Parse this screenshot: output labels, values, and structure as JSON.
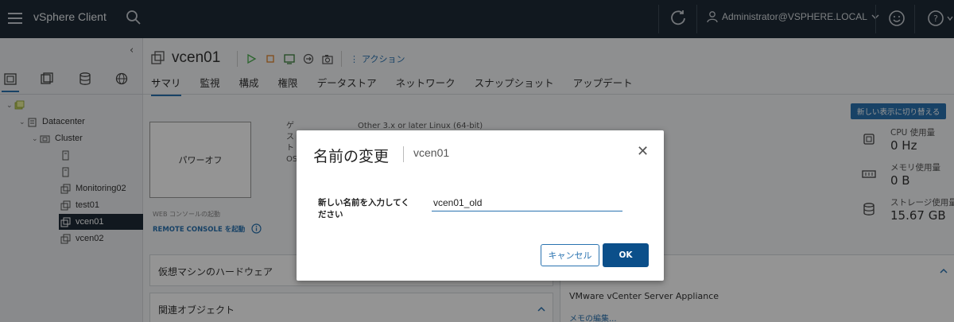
{
  "header": {
    "app_title": "vSphere Client",
    "user": "Administrator@VSPHERE.LOCAL",
    "icons": [
      "menu-icon",
      "search-icon",
      "refresh-icon",
      "user-icon",
      "feedback-icon",
      "help-icon"
    ]
  },
  "nav": {
    "tree": [
      {
        "label": "",
        "type": "vcenter"
      },
      {
        "label": "Datacenter",
        "type": "datacenter"
      },
      {
        "label": "Cluster",
        "type": "cluster"
      },
      {
        "label": "",
        "type": "vm"
      },
      {
        "label": "",
        "type": "vm"
      },
      {
        "label": "Monitoring02",
        "type": "vm"
      },
      {
        "label": "test01",
        "type": "vm"
      },
      {
        "label": "vcen01",
        "type": "vm",
        "selected": true
      },
      {
        "label": "vcen02",
        "type": "vm"
      }
    ]
  },
  "vm": {
    "name": "vcen01",
    "actions_label": "アクション",
    "tabs": [
      "サマリ",
      "監視",
      "構成",
      "権限",
      "データストア",
      "ネットワーク",
      "スナップショット",
      "アップデート"
    ],
    "active_tab": "サマリ",
    "new_view_button": "新しい表示に切り替える",
    "console_label": "パワーオフ",
    "web_console_link": "WEB コンソールの起動",
    "remote_console_link": "REMOTE CONSOLE を起動",
    "guest_os_label": "ゲスト OS:",
    "guest_os_value": "Other 3.x or later Linux (64-bit)",
    "stats": [
      {
        "label": "CPU 使用量",
        "value": "0 Hz",
        "icon": "cpu-icon"
      },
      {
        "label": "メモリ使用量",
        "value": "0 B",
        "icon": "memory-icon"
      },
      {
        "label": "ストレージ使用量",
        "value": "15.67 GB",
        "icon": "storage-icon"
      }
    ],
    "hardware_panel_title": "仮想マシンのハードウェア",
    "related_panel_title": "関連オブジェクト",
    "notes_text": "VMware vCenter Server Appliance",
    "edit_notes_link": "メモの編集..."
  },
  "dialog": {
    "title": "名前の変更",
    "subtitle": "vcen01",
    "field_label": "新しい名前を入力してください",
    "field_value": "vcen01_old",
    "cancel_button": "キャンセル",
    "ok_button": "OK"
  }
}
